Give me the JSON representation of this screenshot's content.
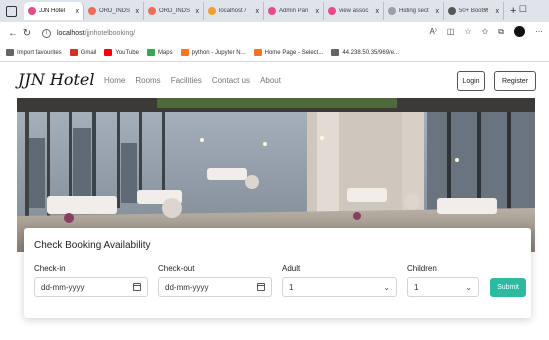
{
  "browser": {
    "tabs": [
      {
        "label": "JJN Hotel",
        "color": "#e84a8a",
        "active": true
      },
      {
        "label": "ORD_INDS",
        "color": "#ef6c5a"
      },
      {
        "label": "ORD_INDS",
        "color": "#ef6c5a"
      },
      {
        "label": "localhost /",
        "color": "#f0a030"
      },
      {
        "label": "Admin Pan",
        "color": "#e84a8a"
      },
      {
        "label": "view assoc",
        "color": "#e84a8a"
      },
      {
        "label": "Hiding sect",
        "color": "#9aa0a6"
      },
      {
        "label": "50+ Bootst",
        "color": "#555555"
      }
    ],
    "tab_close": "x",
    "new_tab": "+",
    "window_controls": "− ☐",
    "url_host": "localhost",
    "url_path": "/jjnhotelbooking/",
    "bookmarks": [
      {
        "label": "Import favourites",
        "color": "#666666"
      },
      {
        "label": "Gmail",
        "color": "#d93025"
      },
      {
        "label": "YouTube",
        "color": "#ff0000"
      },
      {
        "label": "Maps",
        "color": "#34a853"
      },
      {
        "label": "python - Jupyter N...",
        "color": "#f37626"
      },
      {
        "label": "Home Page - Select...",
        "color": "#f37626"
      },
      {
        "label": "44.238.50.35/969/e...",
        "color": "#666666"
      }
    ]
  },
  "site": {
    "brand": "JJN Hotel",
    "menu": [
      "Home",
      "Rooms",
      "Facilities",
      "Contact us",
      "About"
    ],
    "login": "Login",
    "register": "Register"
  },
  "booking": {
    "title": "Check Booking Availability",
    "checkin_label": "Check-in",
    "checkin_value": "dd-mm-yyyy",
    "checkout_label": "Check-out",
    "checkout_value": "dd-mm-yyyy",
    "adult_label": "Adult",
    "adult_value": "1",
    "children_label": "Children",
    "children_value": "1",
    "submit": "Submit",
    "accent": "#2fb9a0"
  }
}
